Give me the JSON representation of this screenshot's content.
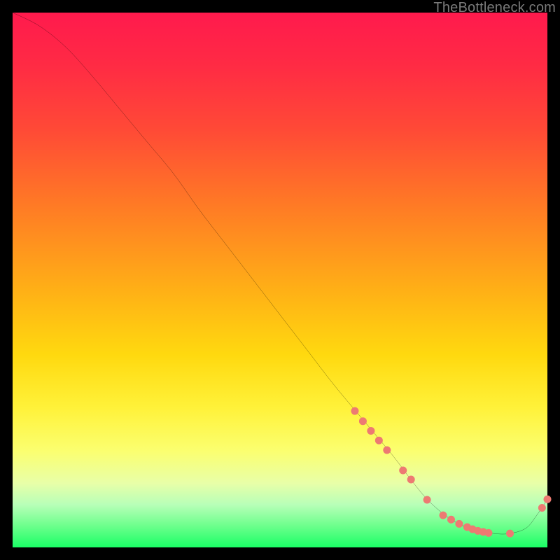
{
  "watermark": "TheBottleneck.com",
  "chart_data": {
    "type": "line",
    "title": "",
    "xlabel": "",
    "ylabel": "",
    "xlim": [
      0,
      100
    ],
    "ylim": [
      0,
      100
    ],
    "curve": {
      "name": "bottleneck-curve",
      "x": [
        0,
        5,
        10,
        15,
        20,
        25,
        30,
        35,
        40,
        45,
        50,
        55,
        60,
        65,
        70,
        72,
        75,
        78,
        82,
        86,
        90,
        93,
        96,
        98,
        100
      ],
      "y": [
        100,
        97.5,
        93.5,
        88,
        82,
        76,
        70,
        63,
        56.5,
        50,
        43.5,
        37,
        30.5,
        24.5,
        18.5,
        16,
        12,
        8.5,
        5.2,
        3.4,
        2.6,
        2.6,
        3.6,
        6.0,
        9.0
      ]
    },
    "markers": {
      "name": "highlighted-points",
      "color": "#ed7a72",
      "radius": 5.5,
      "points": [
        {
          "x": 64.0,
          "y": 25.5
        },
        {
          "x": 65.5,
          "y": 23.6
        },
        {
          "x": 67.0,
          "y": 21.8
        },
        {
          "x": 68.5,
          "y": 20.0
        },
        {
          "x": 70.0,
          "y": 18.2
        },
        {
          "x": 73.0,
          "y": 14.4
        },
        {
          "x": 74.5,
          "y": 12.7
        },
        {
          "x": 77.5,
          "y": 8.9
        },
        {
          "x": 80.5,
          "y": 6.0
        },
        {
          "x": 82.0,
          "y": 5.2
        },
        {
          "x": 83.5,
          "y": 4.4
        },
        {
          "x": 85.0,
          "y": 3.8
        },
        {
          "x": 86.0,
          "y": 3.4
        },
        {
          "x": 87.0,
          "y": 3.1
        },
        {
          "x": 88.0,
          "y": 2.9
        },
        {
          "x": 89.0,
          "y": 2.7
        },
        {
          "x": 93.0,
          "y": 2.6
        },
        {
          "x": 99.0,
          "y": 7.4
        },
        {
          "x": 100.0,
          "y": 9.0
        }
      ]
    }
  }
}
